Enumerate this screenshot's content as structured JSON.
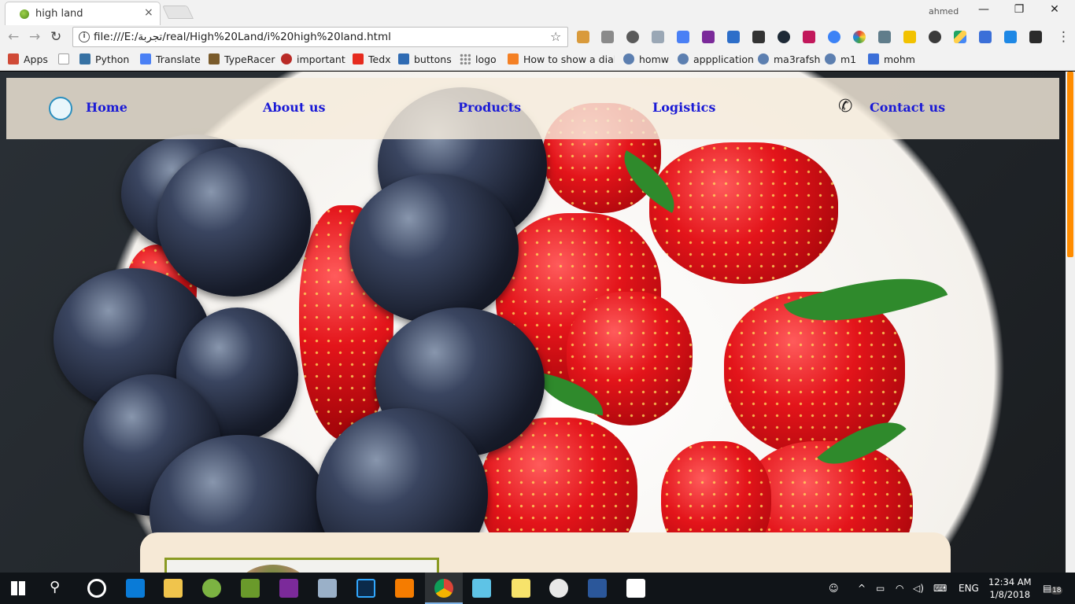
{
  "browser": {
    "tab": {
      "title": "high land",
      "close": "×"
    },
    "profile_name": "ahmed",
    "window_buttons": {
      "minimize": "—",
      "restore": "❐",
      "close": "✕"
    },
    "nav": {
      "back": "←",
      "forward": "→",
      "reload": "↻"
    },
    "url": "file:///E:/تجربة/real/High%20Land/i%20high%20land.html",
    "bookmark_star": "☆"
  },
  "bookmarks": [
    {
      "label": "Apps",
      "icon": "apps-grid-icon",
      "color": "#d04a37"
    },
    {
      "label": "",
      "icon": "page-icon",
      "color": "#9e9e9e"
    },
    {
      "label": "Python",
      "icon": "python-icon",
      "color": "#3671a3"
    },
    {
      "label": "Translate",
      "icon": "translate-icon",
      "color": "#4a80f5"
    },
    {
      "label": "TypeRacer",
      "icon": "typeracer-icon",
      "color": "#7a5b2b"
    },
    {
      "label": "important",
      "icon": "quora-icon",
      "color": "#b92b27"
    },
    {
      "label": "Tedx",
      "icon": "tedx-icon",
      "color": "#e62b1e"
    },
    {
      "label": "buttons",
      "icon": "hm-icon",
      "color": "#2f6bb3"
    },
    {
      "label": "logo",
      "icon": "dots-icon",
      "color": "#888888"
    },
    {
      "label": "How to show a dialog",
      "icon": "stackoverflow-icon",
      "color": "#f48024"
    },
    {
      "label": "homw",
      "icon": "uwc-icon",
      "color": "#5c7fb0"
    },
    {
      "label": "appplication",
      "icon": "uwc-icon",
      "color": "#5c7fb0"
    },
    {
      "label": "ma3rafsh",
      "icon": "uwc-icon",
      "color": "#5c7fb0"
    },
    {
      "label": "m1",
      "icon": "uwc-icon",
      "color": "#5c7fb0"
    },
    {
      "label": "mohm",
      "icon": "doc-icon",
      "color": "#3b6fd8"
    }
  ],
  "site_nav": {
    "items": [
      {
        "label": "Home",
        "icon": "home-icon"
      },
      {
        "label": "About us"
      },
      {
        "label": "Products"
      },
      {
        "label": "Logistics"
      },
      {
        "label": "Contact us",
        "icon": "phone-icon"
      }
    ],
    "link_color": "#1a1ad6"
  },
  "taskbar": {
    "language": "ENG",
    "time": "12:34 AM",
    "date": "1/8/2018",
    "notification_count": "18",
    "active_accent": "#7fb3e6"
  }
}
